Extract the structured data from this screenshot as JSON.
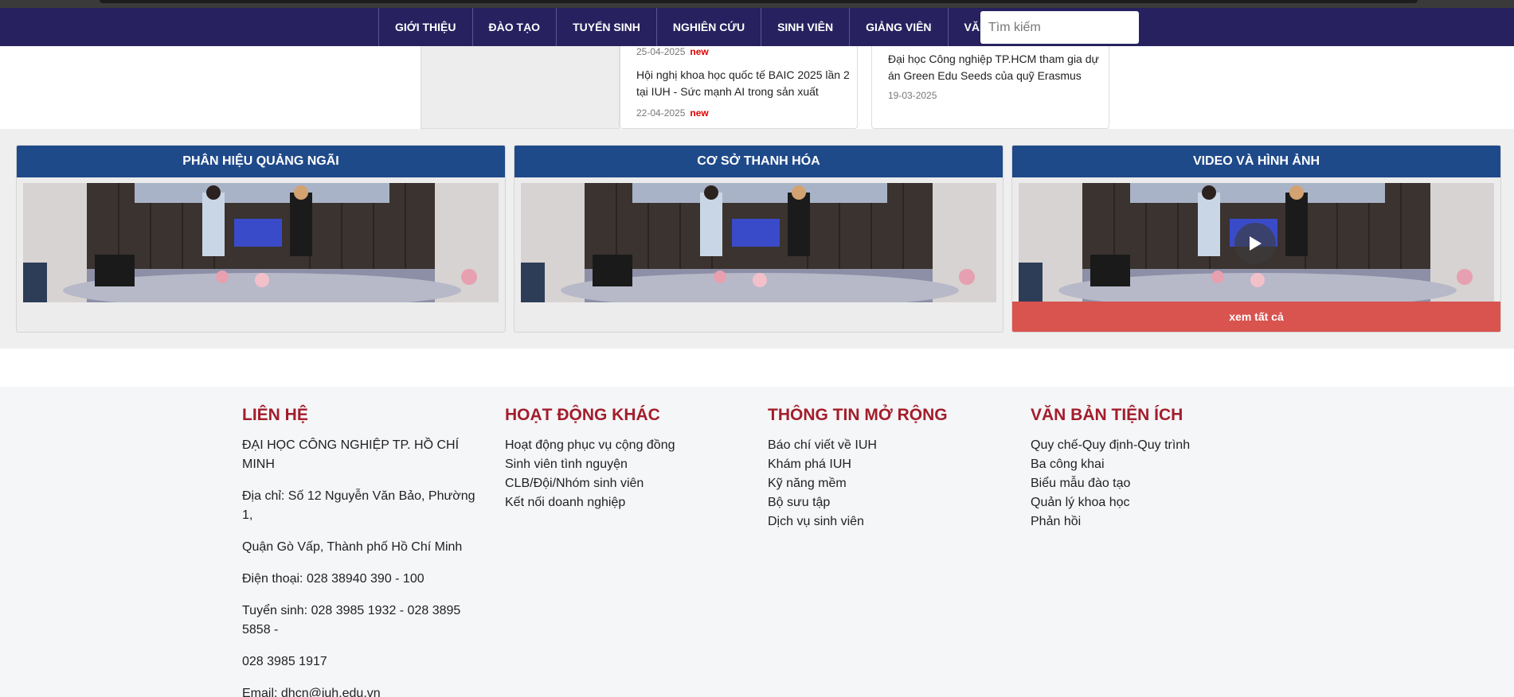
{
  "nav": {
    "items": [
      "GIỚI THIỆU",
      "ĐÀO TẠO",
      "TUYỂN SINH",
      "NGHIÊN CỨU",
      "SINH VIÊN",
      "GIẢNG VIÊN",
      "VĂN BẰNG"
    ],
    "search_placeholder": "Tìm kiếm"
  },
  "news": {
    "card1": {
      "date_top": "25-04-2025",
      "title": "Hội nghị khoa học quốc tế BAIC 2025 lần 2 tại IUH - Sức mạnh AI trong sản xuất",
      "date": "22-04-2025",
      "new_label": "new"
    },
    "card2": {
      "title": "Đại học Công nghiệp TP.HCM tham gia dự án Green Edu Seeds của quỹ Erasmus",
      "date": "19-03-2025"
    }
  },
  "panels": {
    "p1": {
      "title": "PHÂN HIỆU QUẢNG NGÃI"
    },
    "p2": {
      "title": "CƠ SỞ THANH HÓA"
    },
    "p3": {
      "title": "VIDEO VÀ HÌNH ẢNH",
      "see_all": "xem tất cả"
    }
  },
  "footer": {
    "contact": {
      "heading": "LIÊN HỆ",
      "lines": [
        "ĐẠI HỌC CÔNG NGHIỆP TP. HỒ CHÍ MINH",
        "Địa chỉ: Số 12 Nguyễn Văn Bảo, Phường 1,",
        "Quận Gò Vấp, Thành phố Hồ Chí Minh",
        "Điện thoại: 028 38940 390 - 100",
        "Tuyển sinh: 028 3985 1932 - 028 3895 5858 -",
        "028 3985 1917",
        "Email: dhcn@iuh.edu.vn"
      ]
    },
    "activities": {
      "heading": "HOẠT ĐỘNG KHÁC",
      "links": [
        "Hoạt động phục vụ cộng đồng",
        "Sinh viên tình nguyện",
        "CLB/Đội/Nhóm sinh viên",
        "Kết nối doanh nghiệp"
      ]
    },
    "extended": {
      "heading": "THÔNG TIN MỞ RỘNG",
      "links": [
        "Báo chí viết về IUH",
        "Khám phá IUH",
        "Kỹ năng mềm",
        "Bộ sưu tập",
        "Dịch vụ sinh viên"
      ]
    },
    "documents": {
      "heading": "VĂN BẢN TIỆN ÍCH",
      "links": [
        "Quy chế-Quy định-Quy trình",
        "Ba công khai",
        "Biểu mẫu đào tạo",
        "Quản lý khoa học",
        "Phản hồi"
      ]
    }
  },
  "colors": {
    "nav_bg": "#27225f",
    "panel_head": "#1f4a8a",
    "see_all_bg": "#d9534f",
    "footer_heading": "#a31d2b",
    "new_tag": "#e00000"
  }
}
